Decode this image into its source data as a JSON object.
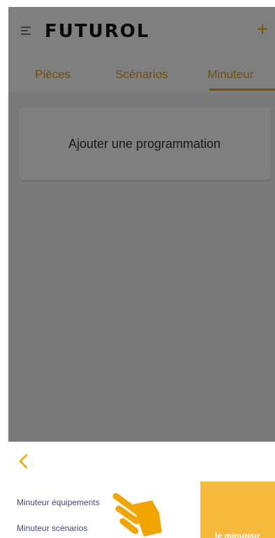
{
  "header": {
    "logo_text": "FUTUROL",
    "add_label": "+"
  },
  "tabs": [
    {
      "label": "Pièces",
      "active": false
    },
    {
      "label": "Scénarios",
      "active": false
    },
    {
      "label": "Minuteur",
      "active": true
    }
  ],
  "main": {
    "add_program_label": "Ajouter une programmation"
  },
  "sheet": {
    "back_icon": "chevron-left-icon",
    "items": [
      {
        "label": "Minuteur équipements"
      },
      {
        "label": "Minuteur scénarios"
      }
    ],
    "promo_text": "le minuteur"
  },
  "colors": {
    "accent": "#f0a500",
    "panel_yellow": "#f6b93b",
    "overlay": "rgba(0,0,0,0.5)"
  }
}
